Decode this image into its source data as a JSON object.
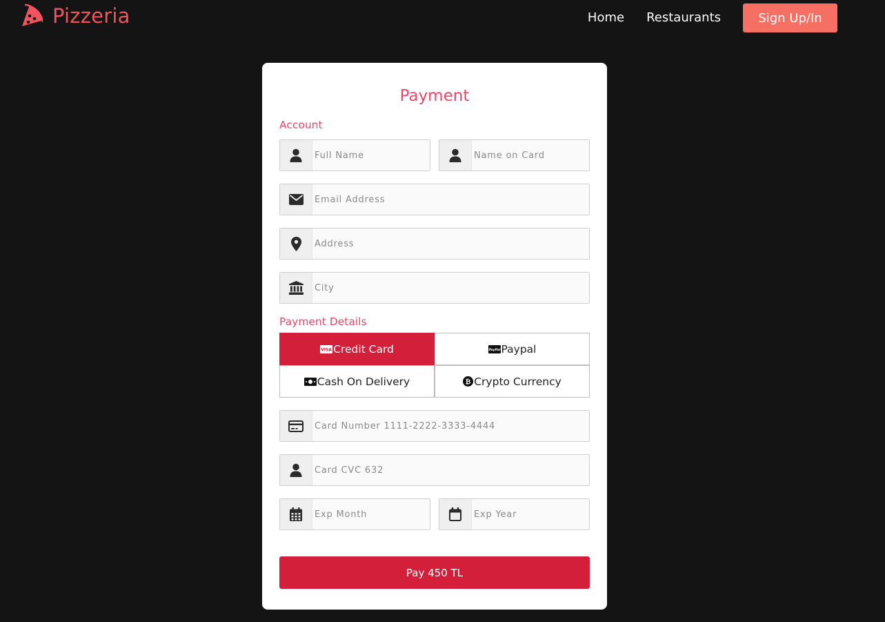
{
  "nav": {
    "brand": "Pizzeria",
    "links": [
      "Home",
      "Restaurants"
    ],
    "signup_label": "Sign Up/In"
  },
  "form": {
    "title": "Payment",
    "account_label": "Account",
    "payment_details_label": "Payment Details",
    "fields": {
      "full_name": {
        "placeholder": "Full Name",
        "value": ""
      },
      "name_on_card": {
        "placeholder": "Name on Card",
        "value": ""
      },
      "email": {
        "placeholder": "Email Address",
        "value": ""
      },
      "address": {
        "placeholder": "Address",
        "value": ""
      },
      "city": {
        "placeholder": "City",
        "value": ""
      },
      "card_number": {
        "placeholder": "Card Number 1111-2222-3333-4444",
        "value": ""
      },
      "card_cvc": {
        "placeholder": "Card CVC 632",
        "value": ""
      },
      "exp_month": {
        "placeholder": "Exp Month",
        "value": ""
      },
      "exp_year": {
        "placeholder": "Exp Year",
        "value": ""
      }
    },
    "payment_methods": [
      {
        "label": "Credit Card",
        "icon": "visa-card-icon",
        "selected": true
      },
      {
        "label": "Paypal",
        "icon": "paypal-icon",
        "selected": false
      },
      {
        "label": "Cash On Delivery",
        "icon": "money-bill-icon",
        "selected": false
      },
      {
        "label": "Crypto Currency",
        "icon": "bitcoin-icon",
        "selected": false
      }
    ],
    "pay_button_label": "Pay 450 TL"
  },
  "colors": {
    "background": "#141414",
    "brand": "#f0545e",
    "accent": "#d31f39",
    "signup": "#f56f62",
    "heading": "#e9476a"
  }
}
